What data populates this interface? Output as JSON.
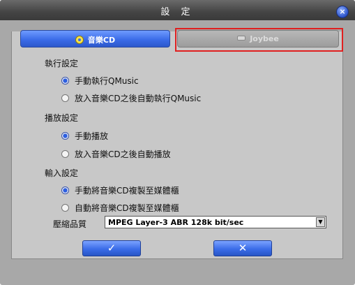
{
  "window": {
    "title": "設 定",
    "close_icon": "×"
  },
  "tabs": [
    {
      "label": "音樂CD",
      "icon": "disc-icon",
      "active": true
    },
    {
      "label": "Joybee",
      "icon": "device-icon",
      "active": false
    }
  ],
  "execution": {
    "heading": "執行設定",
    "options": [
      {
        "label": "手動執行QMusic",
        "checked": true
      },
      {
        "label": "放入音樂CD之後自動執行QMusic",
        "checked": false
      }
    ]
  },
  "playback": {
    "heading": "播放設定",
    "options": [
      {
        "label": "手動播放",
        "checked": true
      },
      {
        "label": "放入音樂CD之後自動播放",
        "checked": false
      }
    ]
  },
  "import": {
    "heading": "輸入設定",
    "options": [
      {
        "label": "手動將音樂CD複製至媒體櫃",
        "checked": true
      },
      {
        "label": "自動將音樂CD複製至媒體櫃",
        "checked": false
      }
    ]
  },
  "quality": {
    "label": "壓縮品質",
    "value": "MPEG Layer-3 ABR 128k bit/sec",
    "arrow": "▼"
  },
  "buttons": {
    "ok": "✓",
    "cancel": "✕"
  },
  "colors": {
    "accent": "#3b6ce8",
    "highlight": "#e02020"
  }
}
